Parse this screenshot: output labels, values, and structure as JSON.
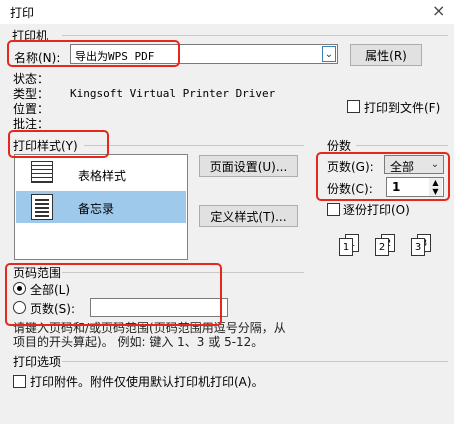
{
  "window": {
    "title": "打印",
    "close": "×"
  },
  "printer": {
    "group": "打印机",
    "name_label": "名称(N):",
    "name_value": "导出为WPS PDF",
    "properties_button": "属性(R)",
    "status_label": "状态：",
    "type_label": "类型：",
    "type_value": "Kingsoft Virtual Printer Driver",
    "location_label": "位置：",
    "comment_label": "批注：",
    "print_to_file": "打印到文件(F)"
  },
  "style": {
    "group": "打印样式(Y)",
    "items": [
      {
        "label": "表格样式"
      },
      {
        "label": "备忘录"
      }
    ],
    "page_setup_button": "页面设置(U)...",
    "define_style_button": "定义样式(T)..."
  },
  "copies": {
    "group": "份数",
    "pages_label": "页数(G):",
    "pages_value": "全部",
    "copies_label": "份数(C):",
    "copies_value": "1",
    "collate": "逐份打印(O)",
    "icon_pages": [
      "1",
      "1",
      "2",
      "2",
      "3",
      "3"
    ]
  },
  "range": {
    "group": "页码范围",
    "all": "全部(L)",
    "pages": "页数(S):",
    "hint1": "请键入页码和/或页码范围(页码范围用逗号分隔，从",
    "hint2": "项目的开头算起)。 例如: 键入 1、3 或 5-12。"
  },
  "options": {
    "group": "打印选项",
    "attachments": "打印附件。附件仅使用默认打印机打印(A)。"
  }
}
